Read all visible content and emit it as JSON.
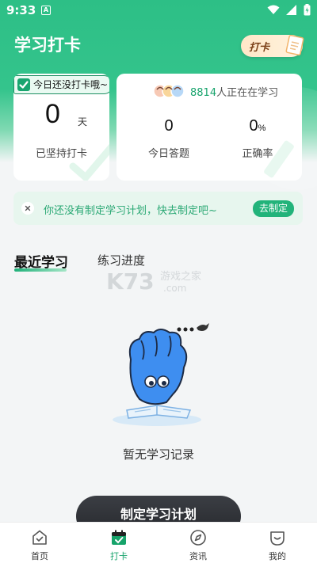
{
  "status_bar": {
    "time": "9:33",
    "app_icon_letter": "A"
  },
  "page_title": "学习打卡",
  "checkin_button": {
    "label": "打卡"
  },
  "streak_card": {
    "tag": "今日还没打卡哦~",
    "days": "0",
    "unit": "天",
    "label": "已坚持打卡"
  },
  "stats_card": {
    "learners_count": "8814",
    "learners_suffix": "人正在在学习",
    "answered_value": "0",
    "answered_label": "今日答题",
    "accuracy_value": "0",
    "accuracy_unit": "%",
    "accuracy_label": "正确率"
  },
  "plan_banner": {
    "text": "你还没有制定学习计划，快去制定吧~",
    "button": "去制定"
  },
  "tabs": [
    {
      "label": "最近学习",
      "active": true
    },
    {
      "label": "练习进度",
      "active": false
    }
  ],
  "watermark": {
    "brand": "K73",
    "text1": "游戏之家",
    "text2": ".com"
  },
  "empty_state": {
    "text": "暂无学习记录"
  },
  "make_plan_button": {
    "label": "制定学习计划"
  },
  "bottom_nav": [
    {
      "label": "首页",
      "icon": "home-icon",
      "active": false
    },
    {
      "label": "打卡",
      "icon": "calendar-check-icon",
      "active": true
    },
    {
      "label": "资讯",
      "icon": "compass-icon",
      "active": false
    },
    {
      "label": "我的",
      "icon": "profile-icon",
      "active": false
    }
  ],
  "colors": {
    "brand_green": "#2dbf86",
    "active_green": "#17a36c",
    "button_dark": "#2a2c30"
  }
}
